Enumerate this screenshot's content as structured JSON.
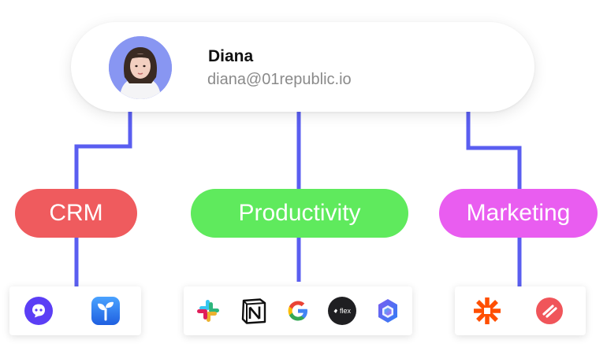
{
  "user": {
    "name": "Diana",
    "email": "diana@01republic.io"
  },
  "categories": [
    {
      "label": "CRM",
      "color": "#ef5b5e"
    },
    {
      "label": "Productivity",
      "color": "#5fea5d"
    },
    {
      "label": "Marketing",
      "color": "#e95df0"
    }
  ],
  "apps": {
    "crm": [
      {
        "icon": "chat-bubble-icon"
      },
      {
        "icon": "sprout-app-icon"
      }
    ],
    "productivity": [
      {
        "icon": "slack-icon"
      },
      {
        "icon": "notion-icon"
      },
      {
        "icon": "google-icon"
      },
      {
        "icon": "flex-icon",
        "text": "flex"
      },
      {
        "icon": "microsoft-365-icon"
      }
    ],
    "marketing": [
      {
        "icon": "zapier-icon"
      },
      {
        "icon": "todoist-icon"
      }
    ]
  },
  "colors": {
    "connector": "#5a5ef0",
    "avatar_bg": "#8896f2"
  }
}
